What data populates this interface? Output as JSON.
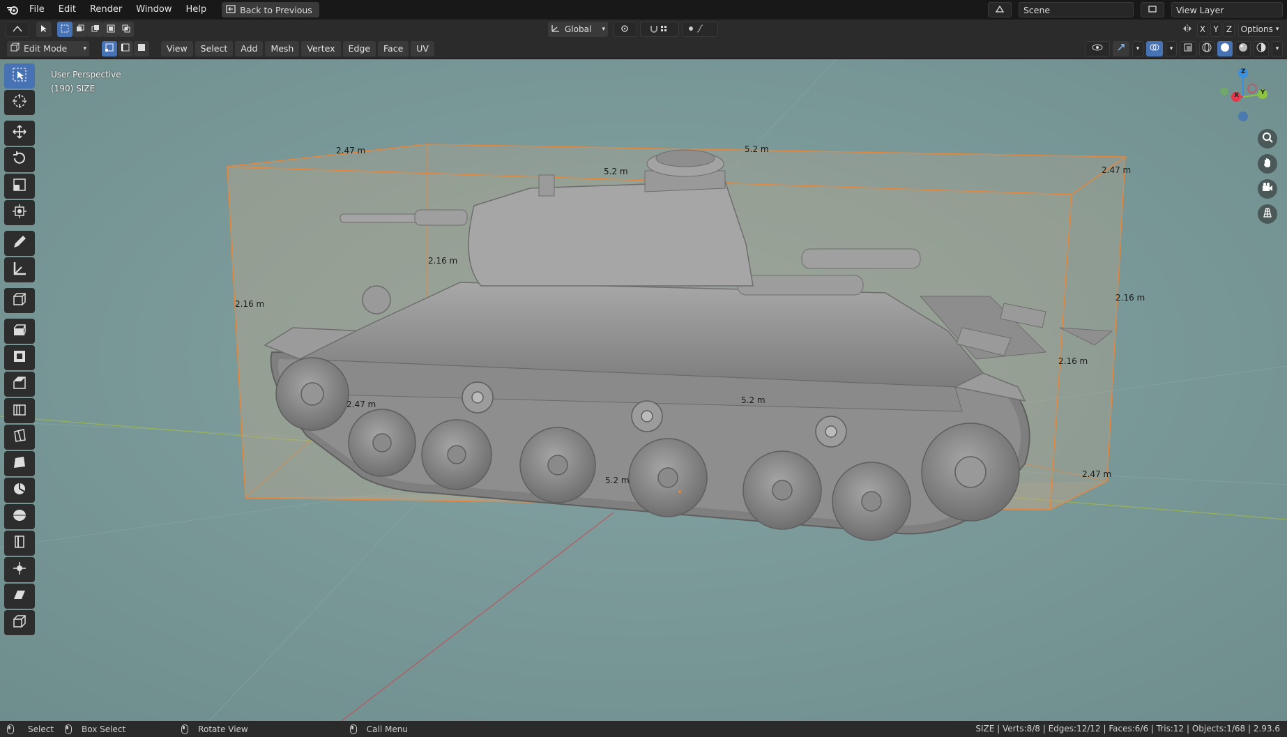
{
  "menu": {
    "file": "File",
    "edit": "Edit",
    "render": "Render",
    "window": "Window",
    "help": "Help",
    "back_to_previous": "Back to Previous"
  },
  "top_right": {
    "scene": "Scene",
    "view_layer": "View Layer"
  },
  "header1": {
    "orientation": "Global",
    "axis_x": "X",
    "axis_y": "Y",
    "axis_z": "Z",
    "options": "Options"
  },
  "header2": {
    "mode": "Edit Mode",
    "menus": [
      "View",
      "Select",
      "Add",
      "Mesh",
      "Vertex",
      "Edge",
      "Face",
      "UV"
    ]
  },
  "viewport": {
    "perspective": "User Perspective",
    "object_info": "(190) SIZE",
    "gizmo": {
      "x": "X",
      "y": "Y",
      "z": "Z"
    },
    "dimensions": [
      "2.47 m",
      "5.2 m",
      "5.2 m",
      "2.47 m",
      "2.16 m",
      "2.16 m",
      "2.16 m",
      "2.16 m",
      "2.47 m",
      "5.2 m",
      "5.2 m",
      "2.47 m"
    ]
  },
  "statusbar": {
    "select": "Select",
    "box_select": "Box Select",
    "rotate_view": "Rotate View",
    "call_menu": "Call Menu",
    "stats": "SIZE | Verts:8/8 | Edges:12/12 | Faces:6/6 | Tris:12 | Objects:1/68 | 2.93.6"
  },
  "colors": {
    "accent": "#4772b3",
    "viewport_bg": "#7a9898",
    "bbox_edge": "#e8863a",
    "axis_x": "#e8374b",
    "axis_y": "#8bc53f",
    "axis_z": "#3b8fe0"
  }
}
